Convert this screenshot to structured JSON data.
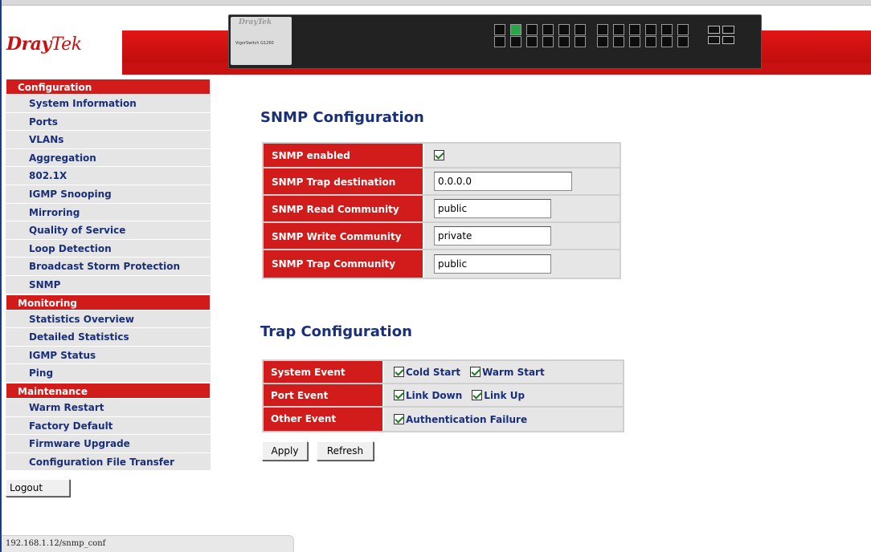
{
  "brand": {
    "logo_main": "Dray",
    "logo_tek": "Tek",
    "model": "VigorSwitch G1260",
    "switch_label": "DrayTek",
    "switch_model": "VigorSwitch G1260"
  },
  "sidebar": {
    "configuration": {
      "title": "Configuration",
      "items": [
        "System Information",
        "Ports",
        "VLANs",
        "Aggregation",
        "802.1X",
        "IGMP Snooping",
        "Mirroring",
        "Quality of Service",
        "Loop Detection",
        "Broadcast Storm Protection",
        "SNMP"
      ]
    },
    "monitoring": {
      "title": "Monitoring",
      "items": [
        "Statistics Overview",
        "Detailed Statistics",
        "IGMP Status",
        "Ping"
      ]
    },
    "maintenance": {
      "title": "Maintenance",
      "items": [
        "Warm Restart",
        "Factory Default",
        "Firmware Upgrade",
        "Configuration File Transfer"
      ]
    },
    "logout": "Logout"
  },
  "snmp": {
    "title": "SNMP Configuration",
    "enabled_label": "SNMP enabled",
    "enabled": true,
    "trap_dest_label": "SNMP Trap destination",
    "trap_dest_value": "0.0.0.0",
    "read_label": "SNMP Read Community",
    "read_value": "public",
    "write_label": "SNMP Write Community",
    "write_value": "private",
    "trap_comm_label": "SNMP Trap Community",
    "trap_comm_value": "public"
  },
  "trap": {
    "title": "Trap Configuration",
    "system_label": "System Event",
    "cold_start": "Cold Start",
    "warm_start": "Warm Start",
    "port_label": "Port Event",
    "link_down": "Link Down",
    "link_up": "Link Up",
    "other_label": "Other Event",
    "auth_failure": "Authentication Failure"
  },
  "buttons": {
    "apply": "Apply",
    "refresh": "Refresh"
  },
  "status": {
    "url": "192.168.1.12/snmp_conf"
  }
}
